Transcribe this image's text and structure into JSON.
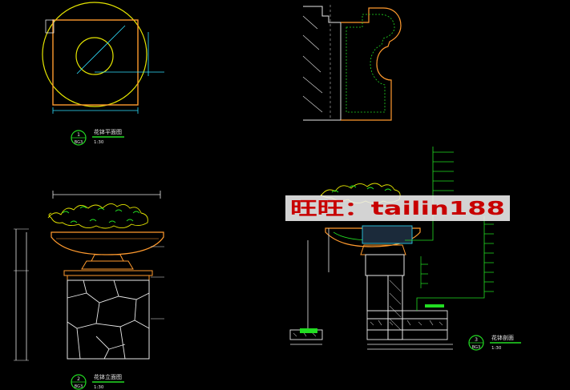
{
  "drawing": {
    "background": "#000000",
    "colors": {
      "yellow": "#e6e600",
      "orange": "#ff9a2e",
      "cyan": "#30e0ff",
      "white": "#e8e8e8",
      "green": "#22dd22",
      "gray": "#9a9a9a",
      "red": "#ff2020",
      "watermark_bg": "#f0f0f0",
      "watermark_text": "#c80000"
    }
  },
  "views": {
    "plan": {
      "title": "花钵平面图",
      "number": "1",
      "code": "BG3",
      "scale": "1:30"
    },
    "elevation": {
      "title": "花钵立面图",
      "number": "2",
      "code": "BG3",
      "scale": "1:30"
    },
    "section": {
      "title": "花钵剖面",
      "number": "3",
      "code": "BG3",
      "scale": "1:30"
    }
  },
  "watermark": {
    "text": "旺旺：tailin188"
  }
}
